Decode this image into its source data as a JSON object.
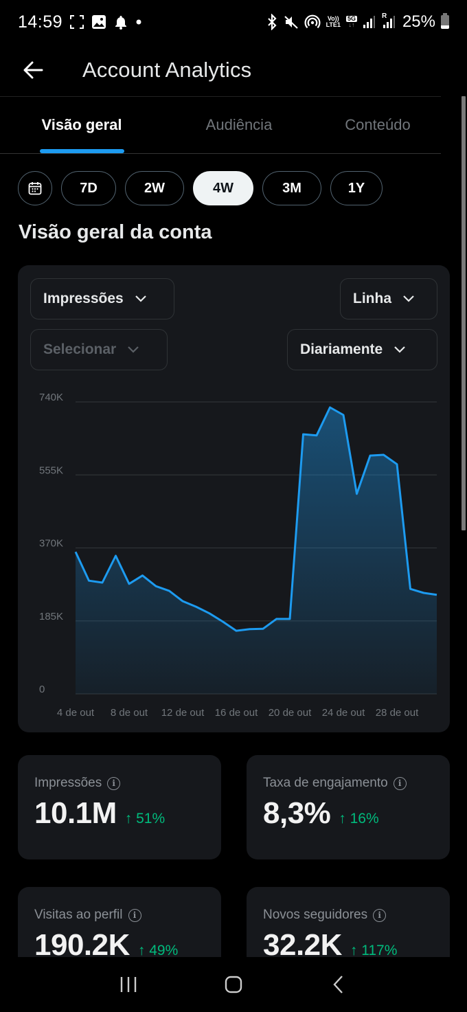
{
  "status_bar": {
    "time": "14:59",
    "left_icons": [
      "screenshot-frame-icon",
      "gallery-icon",
      "bell-icon",
      "dot-icon"
    ],
    "right_icons": [
      "bluetooth-icon",
      "mute-icon",
      "hotspot-icon",
      "volte-icon",
      "5g-icon",
      "signal-icon",
      "roaming-signal-icon"
    ],
    "volte_label_top": "Vo))",
    "volte_label_bottom": "LTE1",
    "network": "5G",
    "roaming": "R",
    "battery": "25%",
    "battery_level": 0.25
  },
  "header": {
    "back_icon": "arrow-left-icon",
    "title": "Account Analytics"
  },
  "tabs": [
    {
      "label": "Visão geral",
      "active": true
    },
    {
      "label": "Audiência",
      "active": false
    },
    {
      "label": "Conteúdo",
      "active": false
    }
  ],
  "range_selector": {
    "calendar_icon": "calendar-icon",
    "options": [
      {
        "label": "7D",
        "active": false
      },
      {
        "label": "2W",
        "active": false
      },
      {
        "label": "4W",
        "active": true
      },
      {
        "label": "3M",
        "active": false
      },
      {
        "label": "1Y",
        "active": false
      }
    ]
  },
  "section_title": "Visão geral da conta",
  "chart_controls": {
    "metric": "Impressões",
    "chart_type": "Linha",
    "compare_placeholder": "Selecionar",
    "interval": "Diariamente"
  },
  "chart_data": {
    "type": "area",
    "title": "",
    "xlabel": "",
    "ylabel": "",
    "series": [
      {
        "name": "Impressões",
        "color": "#1d9bf0",
        "values": [
          360000,
          287000,
          282000,
          350000,
          279000,
          300000,
          273000,
          261000,
          235000,
          221000,
          204000,
          183000,
          160000,
          164000,
          165000,
          190000,
          190000,
          658000,
          655000,
          726000,
          707000,
          507000,
          604000,
          606000,
          582000,
          266000,
          256000,
          251000
        ]
      }
    ],
    "x_start_day": 4,
    "x_count": 28,
    "x_tick_labels": [
      "4 de out",
      "8 de out",
      "12 de out",
      "16 de out",
      "20 de out",
      "24 de out",
      "28 de out"
    ],
    "x_tick_indices": [
      0,
      4,
      8,
      12,
      16,
      20,
      24
    ],
    "y_ticks": [
      0,
      185000,
      370000,
      555000,
      740000
    ],
    "y_tick_labels": [
      "0",
      "185K",
      "370K",
      "555K",
      "740K"
    ],
    "ylim": [
      0,
      740000
    ],
    "grid": true,
    "legend": "none"
  },
  "metrics": [
    {
      "label": "Impressões",
      "value": "10.1M",
      "change": "↑ 51%",
      "direction": "up"
    },
    {
      "label": "Taxa de engajamento",
      "value": "8,3%",
      "change": "↑ 16%",
      "direction": "up"
    },
    {
      "label": "Visitas ao perfil",
      "value": "190.2K",
      "change": "↑ 49%",
      "direction": "up"
    },
    {
      "label": "Novos seguidores",
      "value": "32.2K",
      "change": "↑ 117%",
      "direction": "up"
    }
  ],
  "colors": {
    "accent": "#1d9bf0",
    "positive": "#00ba7c",
    "card_bg": "#16181c",
    "page_bg": "#000000"
  },
  "nav_bar": {
    "buttons": [
      "recent-apps-icon",
      "home-icon",
      "back-icon"
    ]
  }
}
